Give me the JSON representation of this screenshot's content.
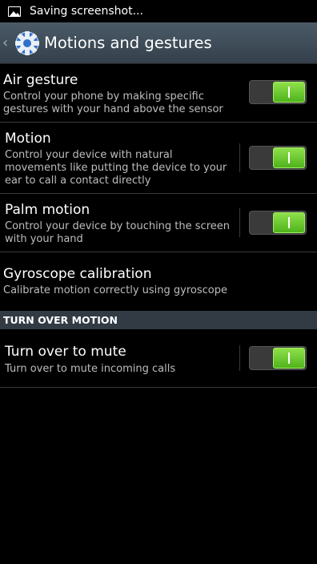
{
  "status_bar": {
    "notification_text": "Saving screenshot..."
  },
  "action_bar": {
    "title": "Motions and gestures"
  },
  "settings": [
    {
      "title": "Air gesture",
      "description": "Control your phone by making specific gestures with your hand above the sensor",
      "toggle": true,
      "toggle_on": true
    },
    {
      "title": "Motion",
      "description": "Control your device with natural movements like putting the device to your ear to call a contact directly",
      "toggle": true,
      "toggle_on": true
    },
    {
      "title": "Palm motion",
      "description": "Control your device by touching the screen with your hand",
      "toggle": true,
      "toggle_on": true
    },
    {
      "title": "Gyroscope calibration",
      "description": "Calibrate motion correctly using gyroscope",
      "toggle": false
    }
  ],
  "section": {
    "header": "TURN OVER MOTION",
    "items": [
      {
        "title": "Turn over to mute",
        "description": "Turn over to mute incoming calls",
        "toggle": true,
        "toggle_on": true
      }
    ]
  },
  "colors": {
    "toggle_on": "#6fd135",
    "action_bar": "#3f4c58",
    "section_header": "#323b44"
  }
}
